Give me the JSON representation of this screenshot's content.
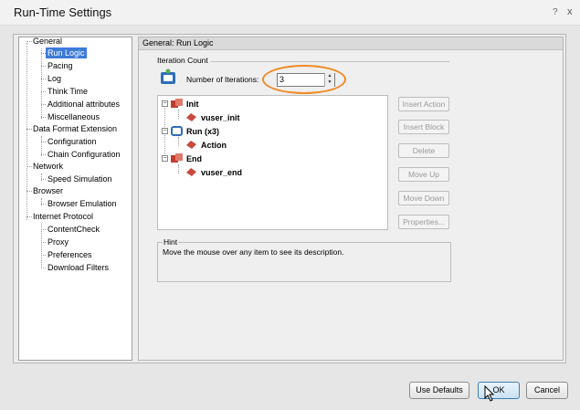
{
  "window": {
    "title": "Run-Time Settings",
    "help_label": "?",
    "close_label": "x"
  },
  "tree": {
    "nodes": [
      {
        "label": "General",
        "level": 0,
        "expanded": true
      },
      {
        "label": "Run Logic",
        "level": 1,
        "selected": true
      },
      {
        "label": "Pacing",
        "level": 1
      },
      {
        "label": "Log",
        "level": 1
      },
      {
        "label": "Think Time",
        "level": 1
      },
      {
        "label": "Additional attributes",
        "level": 1
      },
      {
        "label": "Miscellaneous",
        "level": 1
      },
      {
        "label": "Data Format Extension",
        "level": 0,
        "expanded": true
      },
      {
        "label": "Configuration",
        "level": 1
      },
      {
        "label": "Chain Configuration",
        "level": 1
      },
      {
        "label": "Network",
        "level": 0,
        "expanded": true
      },
      {
        "label": "Speed Simulation",
        "level": 1
      },
      {
        "label": "Browser",
        "level": 0,
        "expanded": true
      },
      {
        "label": "Browser Emulation",
        "level": 1
      },
      {
        "label": "Internet Protocol",
        "level": 0,
        "expanded": true
      },
      {
        "label": "ContentCheck",
        "level": 1
      },
      {
        "label": "Proxy",
        "level": 1
      },
      {
        "label": "Preferences",
        "level": 1
      },
      {
        "label": "Download Filters",
        "level": 1
      }
    ]
  },
  "panel": {
    "header": "General: Run Logic",
    "iteration_group_label": "Iteration Count",
    "iterations_label": "Number of Iterations:",
    "iterations_value": "3",
    "flow": [
      {
        "label": "Init",
        "type": "section"
      },
      {
        "label": "vuser_init",
        "type": "action"
      },
      {
        "label": "Run (x3)",
        "type": "run"
      },
      {
        "label": "Action",
        "type": "action"
      },
      {
        "label": "End",
        "type": "section"
      },
      {
        "label": "vuser_end",
        "type": "action"
      }
    ],
    "side_buttons": {
      "insert_action": "Insert Action",
      "insert_block": "Insert Block",
      "delete": "Delete",
      "move_up": "Move Up",
      "move_down": "Move Down",
      "properties": "Properties..."
    },
    "hint_title": "Hint",
    "hint_text": "Move the mouse over any item to see its description."
  },
  "footer": {
    "use_defaults": "Use Defaults",
    "ok": "OK",
    "cancel": "Cancel"
  },
  "colors": {
    "selection": "#3d7bd8",
    "highlight": "#f08a24"
  }
}
